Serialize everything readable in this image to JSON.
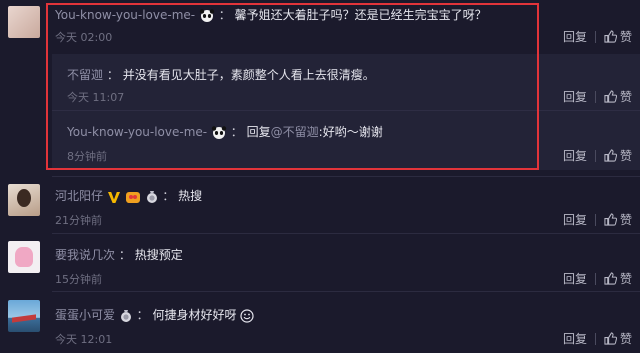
{
  "comments": [
    {
      "user": "You-know-you-love-me-",
      "colon": "：",
      "text": "馨予姐还大着肚子吗？还是已经生完宝宝了呀？",
      "time": "今天 02:00",
      "reply": "回复",
      "like": "赞"
    },
    {
      "user": "河北阳仔",
      "colon": "：",
      "text": "热搜",
      "time": "21分钟前",
      "reply": "回复",
      "like": "赞"
    },
    {
      "user": "要我说几次",
      "colon": "：",
      "text": "热搜预定",
      "time": "15分钟前",
      "reply": "回复",
      "like": "赞"
    },
    {
      "user": "蛋蛋小可爱",
      "colon": "：",
      "text": "何捷身材好好呀",
      "time": "今天 12:01",
      "reply": "回复",
      "like": "赞"
    }
  ],
  "replies": [
    {
      "user": "不留迦",
      "colon": "：",
      "text": "并没有看见大肚子，素颜整个人看上去很清瘦。",
      "time": "今天 11:07",
      "reply": "回复",
      "like": "赞"
    },
    {
      "user": "You-know-you-love-me-",
      "colon": "：",
      "reply_prefix": "回复",
      "mention": "@不留迦",
      "text": ":好哟～谢谢",
      "time": "8分钟前",
      "reply": "回复",
      "like": "赞"
    }
  ],
  "colors": {
    "background": "#1b1a2c",
    "sub_background": "#232337",
    "highlight": "#e2343a",
    "username": "#8f8fa6",
    "timestamp": "#6f6f82"
  }
}
